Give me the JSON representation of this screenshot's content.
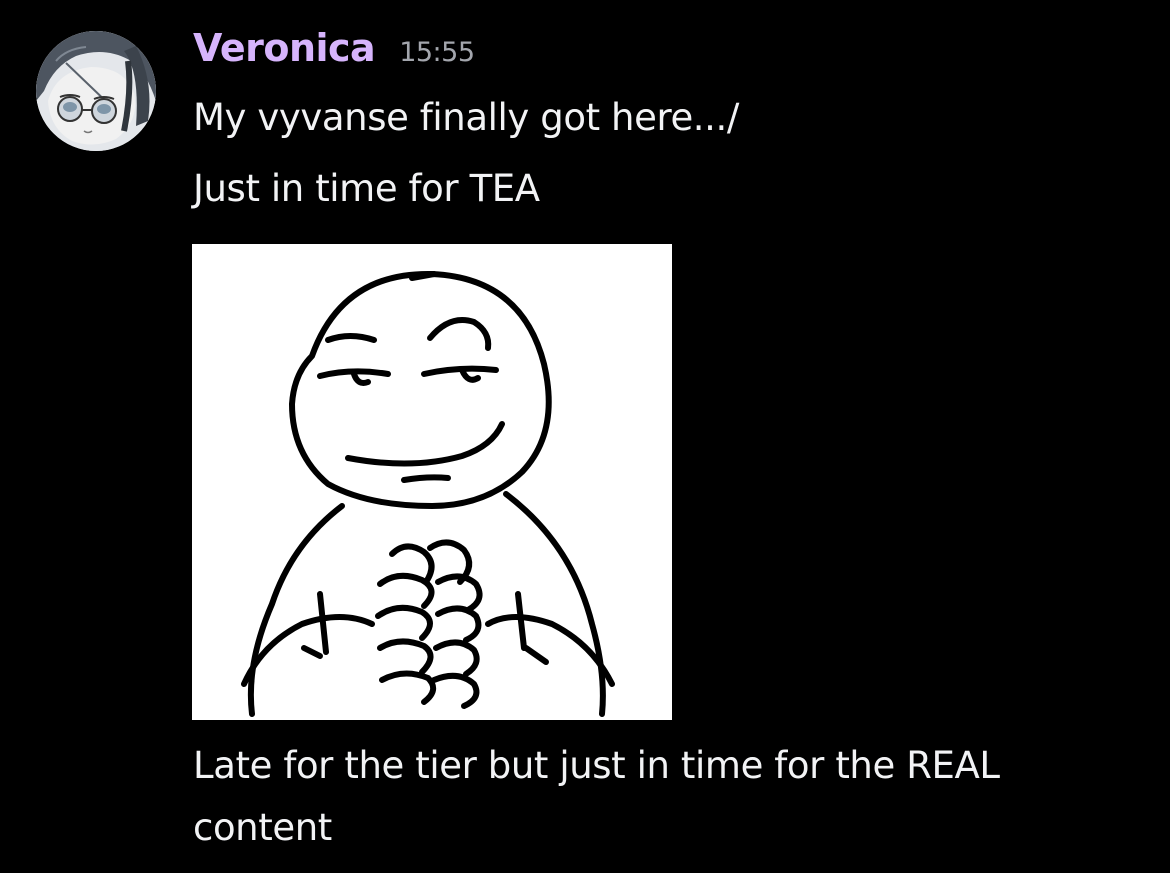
{
  "message": {
    "author": {
      "name": "Veronica",
      "name_color": "#d6b4fc",
      "avatar_icon": "anime-girl-glasses-avatar"
    },
    "timestamp": "15:55",
    "lines": [
      "My vyvanse finally got here.../",
      "Just in time for TEA"
    ],
    "attachment": {
      "type": "image",
      "icon": "smug-wojak-hands-together-meme"
    },
    "follow_up": "Late for the tier but just in time for the REAL content"
  },
  "colors": {
    "background": "#000000",
    "text": "#f2f3f5",
    "timestamp": "#a3a6ad"
  }
}
